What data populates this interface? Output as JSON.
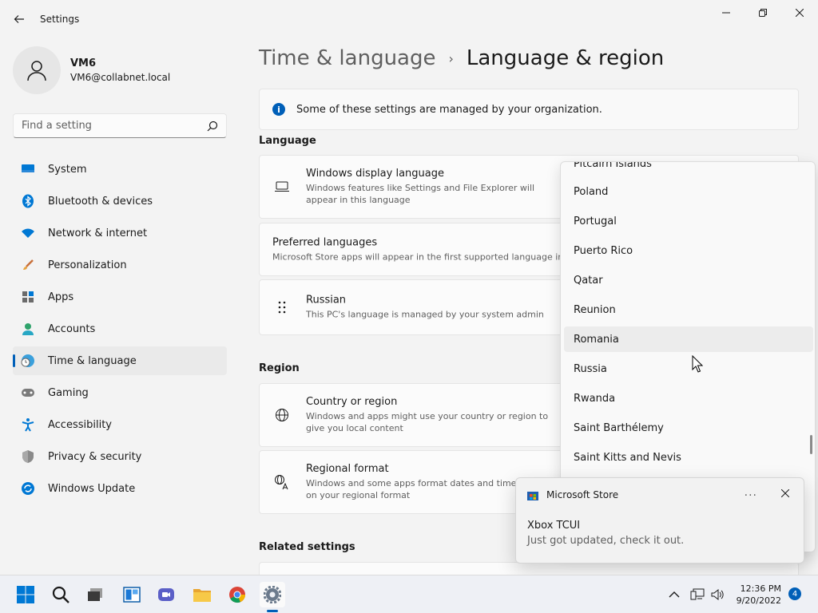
{
  "window": {
    "title": "Settings"
  },
  "user": {
    "name": "VM6",
    "email": "VM6@collabnet.local"
  },
  "search": {
    "placeholder": "Find a setting"
  },
  "nav": {
    "items": [
      {
        "label": "System",
        "icon": "monitor-icon"
      },
      {
        "label": "Bluetooth & devices",
        "icon": "bluetooth-icon"
      },
      {
        "label": "Network & internet",
        "icon": "wifi-icon"
      },
      {
        "label": "Personalization",
        "icon": "brush-icon"
      },
      {
        "label": "Apps",
        "icon": "apps-icon"
      },
      {
        "label": "Accounts",
        "icon": "person-icon"
      },
      {
        "label": "Time & language",
        "icon": "clock-globe-icon",
        "active": true
      },
      {
        "label": "Gaming",
        "icon": "gamepad-icon"
      },
      {
        "label": "Accessibility",
        "icon": "accessibility-icon"
      },
      {
        "label": "Privacy & security",
        "icon": "shield-icon"
      },
      {
        "label": "Windows Update",
        "icon": "update-icon"
      }
    ]
  },
  "breadcrumb": {
    "parent": "Time & language",
    "separator": "›",
    "current": "Language & region"
  },
  "info": {
    "text": "Some of these settings are managed by your organization."
  },
  "language_section": {
    "label": "Language",
    "display_language": {
      "title": "Windows display language",
      "subtitle": "Windows features like Settings and File Explorer will appear in this language"
    },
    "preferred": {
      "title": "Preferred languages",
      "subtitle": "Microsoft Store apps will appear in the first supported language in this list"
    },
    "russian": {
      "title": "Russian",
      "subtitle": "This PC's language is managed by your system admin"
    }
  },
  "region_section": {
    "label": "Region",
    "country": {
      "title": "Country or region",
      "subtitle": "Windows and apps might use your country or region to give you local content"
    },
    "format": {
      "title": "Regional format",
      "subtitle": "Windows and some apps format dates and times based on your regional format"
    }
  },
  "related": {
    "label": "Related settings"
  },
  "dropdown": {
    "items": [
      "Pitcairn Islands",
      "Poland",
      "Portugal",
      "Puerto Rico",
      "Qatar",
      "Reunion",
      "Romania",
      "Russia",
      "Rwanda",
      "Saint Barthélemy",
      "Saint Kitts and Nevis"
    ],
    "hovered": "Romania"
  },
  "toast": {
    "app": "Microsoft Store",
    "more": "···",
    "title": "Xbox TCUI",
    "body": "Just got updated, check it out."
  },
  "taskbar": {
    "time": "12:36 PM",
    "date": "9/20/2022",
    "notification_count": "4"
  },
  "colors": {
    "accent": "#005fb8",
    "background": "#f3f3f3"
  }
}
